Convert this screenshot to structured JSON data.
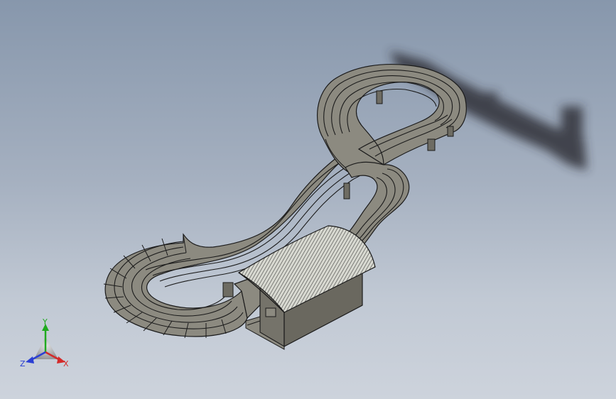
{
  "view": {
    "background_top": "#8797ac",
    "background_bottom": "#cdd3dc",
    "model_fill": "#8a887e",
    "model_edge": "#1b1b1b",
    "roof_fill": "#cfd0c8",
    "wall_fill": "#6e6c63"
  },
  "triad": {
    "y_label": "Y",
    "x_label": "X",
    "z_label": "Z",
    "y_color": "#1faa1f",
    "x_color": "#d42a2a",
    "z_color": "#2a3fd4"
  }
}
